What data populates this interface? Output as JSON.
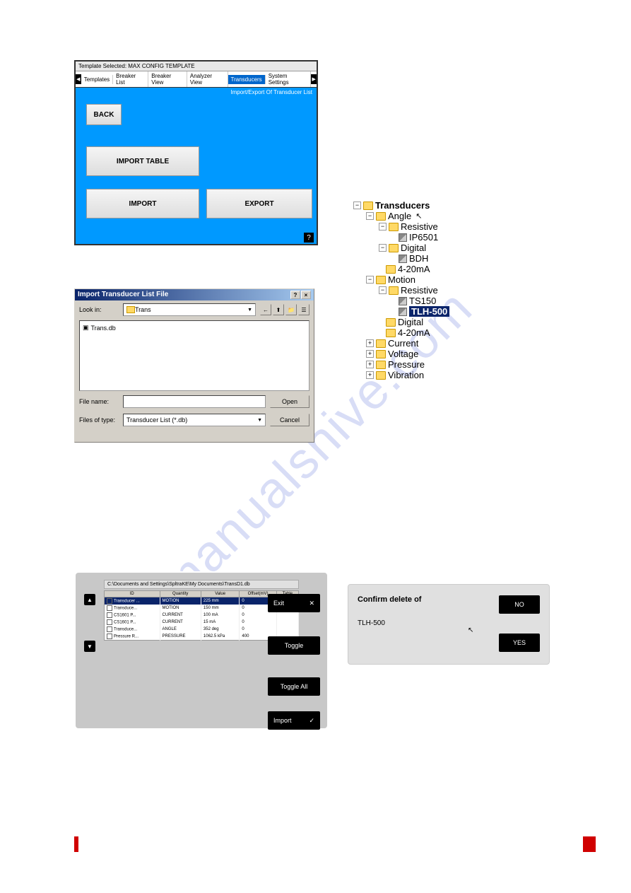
{
  "watermark": "manualshive.com",
  "panel1": {
    "header": "Template Selected: MAX CONFIG TEMPLATE",
    "tabs": [
      "Templates",
      "Breaker List",
      "Breaker View",
      "Analyzer View",
      "Transducers",
      "System Settings"
    ],
    "active_tab_index": 4,
    "subhead": "Import/Export Of Transducer List",
    "back": "BACK",
    "import_table": "IMPORT TABLE",
    "import": "IMPORT",
    "export": "EXPORT",
    "help": "?"
  },
  "panel2": {
    "title": "Import Transducer List File",
    "look_in_label": "Look in:",
    "look_in_value": "Trans",
    "file": "Trans.db",
    "filename_label": "File name:",
    "filename_value": "",
    "filestype_label": "Files of type:",
    "filestype_value": "Transducer List (*.db)",
    "open": "Open",
    "cancel": "Cancel"
  },
  "tree": {
    "root": "Transducers",
    "angle": "Angle",
    "resistive": "Resistive",
    "ip6501": "IP6501",
    "digital": "Digital",
    "bdh": "BDH",
    "a420": "4-20mA",
    "motion": "Motion",
    "ts150": "TS150",
    "tlh500": "TLH-500",
    "current": "Current",
    "voltage": "Voltage",
    "pressure": "Pressure",
    "vibration": "Vibration"
  },
  "panel4": {
    "path": "C:\\Documents and Settings\\SpltraKE\\My Documents\\TransD1.db",
    "cols": [
      "ID",
      "Quantity",
      "Value",
      "Offset(mV)",
      "Table"
    ],
    "rows": [
      {
        "id": "Transducer ...",
        "q": "MOTION",
        "v": "225 mm",
        "o": "0",
        "t": ""
      },
      {
        "id": "Transduce...",
        "q": "MOTION",
        "v": "150 mm",
        "o": "0",
        "t": ""
      },
      {
        "id": "CS1601 P...",
        "q": "CURRENT",
        "v": "100 mA",
        "o": "0",
        "t": ""
      },
      {
        "id": "CS1601 P...",
        "q": "CURRENT",
        "v": "15 mA",
        "o": "0",
        "t": ""
      },
      {
        "id": "Transduce...",
        "q": "ANGLE",
        "v": "352 deg",
        "o": "0",
        "t": ""
      },
      {
        "id": "Pressure R...",
        "q": "PRESSURE",
        "v": "1062.5 kPa",
        "o": "400",
        "t": ""
      }
    ],
    "exit": "Exit",
    "toggle": "Toggle",
    "toggle_all": "Toggle All",
    "import": "Import"
  },
  "panel5": {
    "msg": "Confirm delete of",
    "item": "TLH-500",
    "no": "NO",
    "yes": "YES"
  }
}
